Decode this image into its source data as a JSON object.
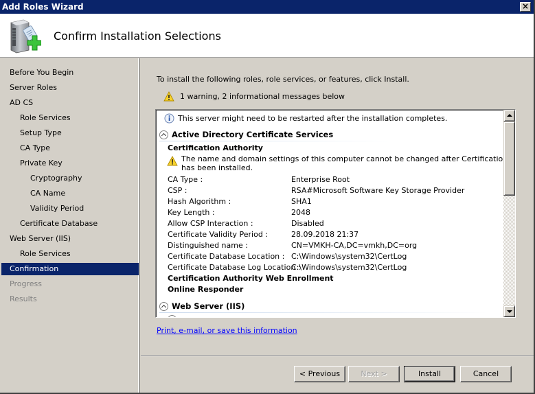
{
  "window": {
    "title": "Add Roles Wizard",
    "close_label": "✕"
  },
  "header": {
    "title": "Confirm Installation Selections",
    "icon": "server-add-role-icon"
  },
  "sidebar": {
    "items": [
      {
        "label": "Before You Begin",
        "level": 0,
        "state": "normal"
      },
      {
        "label": "Server Roles",
        "level": 0,
        "state": "normal"
      },
      {
        "label": "AD CS",
        "level": 0,
        "state": "normal"
      },
      {
        "label": "Role Services",
        "level": 1,
        "state": "normal"
      },
      {
        "label": "Setup Type",
        "level": 1,
        "state": "normal"
      },
      {
        "label": "CA Type",
        "level": 1,
        "state": "normal"
      },
      {
        "label": "Private Key",
        "level": 1,
        "state": "normal"
      },
      {
        "label": "Cryptography",
        "level": 2,
        "state": "normal"
      },
      {
        "label": "CA Name",
        "level": 2,
        "state": "normal"
      },
      {
        "label": "Validity Period",
        "level": 2,
        "state": "normal"
      },
      {
        "label": "Certificate Database",
        "level": 1,
        "state": "normal"
      },
      {
        "label": "Web Server (IIS)",
        "level": 0,
        "state": "normal"
      },
      {
        "label": "Role Services",
        "level": 1,
        "state": "normal"
      },
      {
        "label": "Confirmation",
        "level": 0,
        "state": "active"
      },
      {
        "label": "Progress",
        "level": 0,
        "state": "disabled"
      },
      {
        "label": "Results",
        "level": 0,
        "state": "disabled"
      }
    ]
  },
  "content": {
    "intro": "To install the following roles, role services, or features, click Install.",
    "warning_summary": "1 warning, 2 informational messages below",
    "info_message": "This server might need to be restarted after the installation completes.",
    "sections": [
      {
        "title": "Active Directory Certificate Services",
        "subsections": [
          {
            "title": "Certification Authority",
            "warning": "The name and domain settings of this computer cannot be changed after Certification Authority has been installed.",
            "warning_line1": "The name and domain settings of this computer cannot be changed after Certification Authority",
            "warning_line2": "has been installed.",
            "properties": [
              {
                "label": "CA Type :",
                "value": "Enterprise Root"
              },
              {
                "label": "CSP :",
                "value": "RSA#Microsoft Software Key Storage Provider"
              },
              {
                "label": "Hash Algorithm :",
                "value": "SHA1"
              },
              {
                "label": "Key Length :",
                "value": "2048"
              },
              {
                "label": "Allow CSP Interaction :",
                "value": "Disabled"
              },
              {
                "label": "Certificate Validity Period :",
                "value": "28.09.2018 21:37"
              },
              {
                "label": "Distinguished name :",
                "value": "CN=VMKH-CA,DC=vmkh,DC=org"
              },
              {
                "label": "Certificate Database Location :",
                "value": "C:\\Windows\\system32\\CertLog"
              },
              {
                "label": "Certificate Database Log Location :",
                "value": "C:\\Windows\\system32\\CertLog"
              }
            ]
          },
          {
            "title": "Certification Authority Web Enrollment"
          },
          {
            "title": "Online Responder"
          }
        ]
      },
      {
        "title": "Web Server (IIS)"
      }
    ],
    "link": "Print, e-mail, or save this information"
  },
  "buttons": {
    "previous": "< Previous",
    "next": "Next >",
    "install": "Install",
    "cancel": "Cancel"
  },
  "colors": {
    "titlebar": "#0a246a",
    "selection": "#0a246a",
    "link": "#0000ff",
    "face": "#d4d0c8"
  }
}
